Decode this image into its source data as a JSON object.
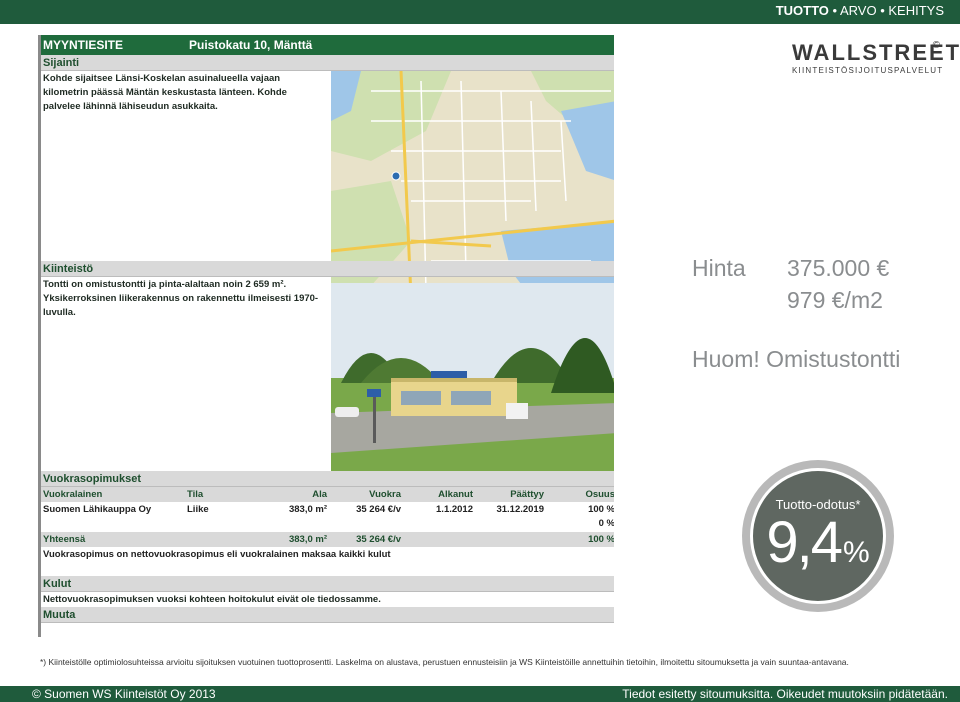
{
  "topbar": {
    "w1": "TUOTTO",
    "sep1": " • ",
    "w2": "ARVO",
    "sep2": " • ",
    "w3": "KEHITYS"
  },
  "logo": {
    "line1": "WALLSTREET",
    "line2": "KIINTEISTÖSIJOITUSPALVELUT",
    "reg": "©"
  },
  "sheet": {
    "header_left": "MYYNTIESITE",
    "header_right": "Puistokatu 10, Mänttä",
    "sijainti": {
      "title": "Sijainti",
      "lines": [
        "Kohde sijaitsee Länsi-Koskelan asuinalueella vajaan",
        "kilometrin päässä Mäntän keskustasta länteen. Kohde",
        "palvelee lähinnä lähiseudun asukkaita."
      ]
    },
    "kiinteisto": {
      "title": "Kiinteistö",
      "lines": [
        "Tontti on omistustontti ja pinta-alaltaan noin 2 659 m².",
        "Yksikerroksinen liikerakennus on rakennettu ilmeisesti 1970-",
        "luvulla."
      ]
    },
    "vuokra": {
      "title": "Vuokrasopimukset",
      "headers": [
        "Vuokralainen",
        "Tila",
        "Ala",
        "Vuokra",
        "Alkanut",
        "Päättyy",
        "Osuus"
      ],
      "row": [
        "Suomen Lähikauppa Oy",
        "Liike",
        "383,0 m²",
        "35 264 €/v",
        "1.1.2012",
        "31.12.2019",
        "100 %"
      ],
      "row2_osuus": "0 %",
      "total": [
        "Yhteensä",
        "383,0 m²",
        "35 264 €/v",
        "100 %"
      ],
      "note": "Vuokrasopimus on nettovuokrasopimus eli vuokralainen maksaa kaikki kulut"
    },
    "kulut": {
      "title": "Kulut",
      "text": "Nettovuokrasopimuksen vuoksi kohteen hoitokulut eivät ole tiedossamme."
    },
    "muuta": {
      "title": "Muuta"
    }
  },
  "price": {
    "label": "Hinta",
    "value": "375.000 €",
    "per_m2": "979 €/m2",
    "note": "Huom! Omistustontti"
  },
  "badge": {
    "label": "Tuotto-odotus*",
    "value": "9,4",
    "unit": "%"
  },
  "footnote": "*) Kiinteistölle optimiolosuhteissa arvioitu sijoituksen vuotuinen tuottoprosentti. Laskelma on alustava, perustuen ennusteisiin ja WS Kiinteistöille annettuihin tietoihin, ilmoitettu sitoumuksetta ja vain suuntaa-antavana.",
  "footer": {
    "left": "© Suomen WS Kiinteistöt Oy 2013",
    "right": "Tiedot esitetty sitoumuksitta. Oikeudet muutoksiin pidätetään."
  },
  "colors": {
    "brand_green": "#1f5b3c",
    "badge_grey": "#5f6761",
    "text_grey": "#8a8d8f"
  }
}
